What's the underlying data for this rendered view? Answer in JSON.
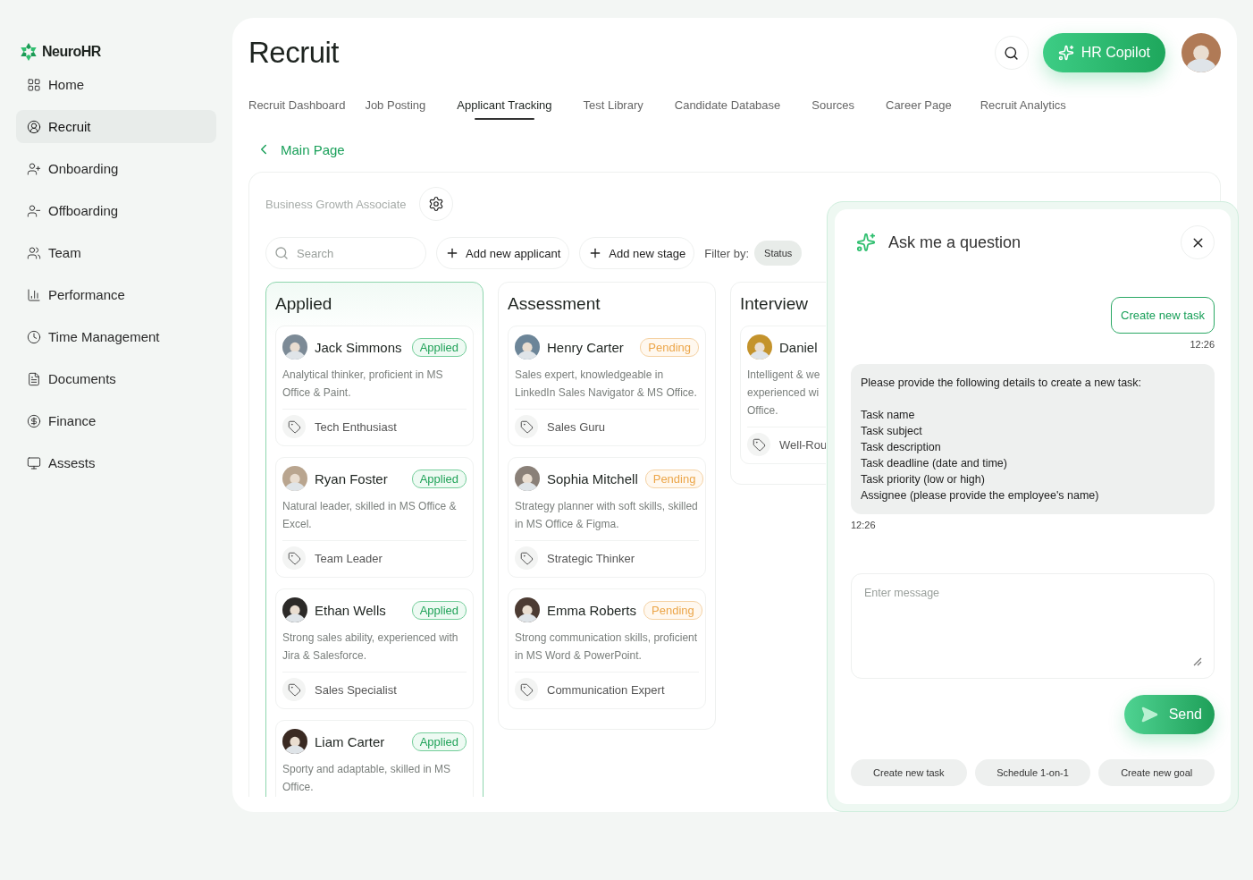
{
  "sidebar": {
    "brand": "NeuroHR",
    "items": [
      {
        "label": "Home",
        "selected": false
      },
      {
        "label": "Recruit",
        "selected": true
      },
      {
        "label": "Onboarding",
        "selected": false
      },
      {
        "label": "Offboarding",
        "selected": false
      },
      {
        "label": "Team",
        "selected": false
      },
      {
        "label": "Performance",
        "selected": false
      },
      {
        "label": "Time Management",
        "selected": false
      },
      {
        "label": "Documents",
        "selected": false
      },
      {
        "label": "Finance",
        "selected": false
      },
      {
        "label": "Assests",
        "selected": false
      }
    ]
  },
  "header": {
    "title": "Recruit",
    "copilot": "HR Copilot"
  },
  "tabs": [
    {
      "label": "Recruit Dashboard",
      "selected": false
    },
    {
      "label": "Job Posting",
      "selected": false
    },
    {
      "label": "Applicant Tracking",
      "selected": true
    },
    {
      "label": "Test Library",
      "selected": false
    },
    {
      "label": "Candidate Database",
      "selected": false
    },
    {
      "label": "Sources",
      "selected": false
    },
    {
      "label": "Career Page",
      "selected": false
    },
    {
      "label": "Recruit Analytics",
      "selected": false
    }
  ],
  "back_link": "Main Page",
  "board": {
    "job_title": "Business Growth Associate",
    "search": {
      "placeholder": "Search"
    },
    "actions": [
      "Add new applicant",
      "Add new stage"
    ],
    "filter_label": "Filter by:",
    "filters": [
      "Status"
    ],
    "columns": [
      {
        "title": "Applied",
        "selected": true,
        "cards": [
          {
            "name": "Jack Simmons",
            "status": {
              "label": "Applied",
              "kind": "applied"
            },
            "description": "Analytical thinker, proficient in MS Office & Paint.",
            "tag": "Tech Enthusiast"
          },
          {
            "name": "Ryan Foster",
            "status": {
              "label": "Applied",
              "kind": "applied"
            },
            "description": "Natural leader, skilled in MS Office & Excel.",
            "tag": "Team Leader"
          },
          {
            "name": "Ethan Wells",
            "status": {
              "label": "Applied",
              "kind": "applied"
            },
            "description": "Strong sales ability, experienced with Jira & Salesforce.",
            "tag": "Sales Specialist"
          },
          {
            "name": "Liam Carter",
            "status": {
              "label": "Applied",
              "kind": "applied"
            },
            "description": "Sporty and adaptable, skilled in MS Office."
          }
        ]
      },
      {
        "title": "Assessment",
        "selected": false,
        "cards": [
          {
            "name": "Henry Carter",
            "status": {
              "label": "Pending",
              "kind": "pending"
            },
            "description": "Sales expert, knowledgeable in LinkedIn Sales Navigator & MS Office.",
            "tag": "Sales Guru"
          },
          {
            "name": "Sophia Mitchell",
            "status": {
              "label": "Pending",
              "kind": "pending"
            },
            "description": "Strategy planner with soft skills, skilled in MS Office & Figma.",
            "tag": "Strategic Thinker"
          },
          {
            "name": "Emma Roberts",
            "status": {
              "label": "Pending",
              "kind": "pending"
            },
            "description": "Strong communication skills, proficient in MS Word & PowerPoint.",
            "tag": "Communication Expert"
          }
        ]
      },
      {
        "title": "Interview",
        "selected": false,
        "cards": [
          {
            "name": "Daniel",
            "description": "Intelligent & we\nexperienced wi\nOffice.",
            "tag": "Well-Rou"
          }
        ]
      }
    ]
  },
  "chat": {
    "title": "Ask me a question",
    "messages": [
      {
        "kind": "user",
        "text": "Create new task",
        "time": "12:26"
      },
      {
        "kind": "bot",
        "text": "Please provide the following details to create a new task:",
        "items": [
          "Task name",
          "Task subject",
          "Task description",
          "Task deadline (date and time)",
          "Task priority (low or high)",
          "Assignee (please provide the employee's name)"
        ],
        "time": "12:26"
      }
    ],
    "input": {
      "placeholder": "Enter message"
    },
    "send": "Send",
    "suggestions": [
      "Create new task",
      "Schedule 1-on-1",
      "Create new goal"
    ]
  }
}
